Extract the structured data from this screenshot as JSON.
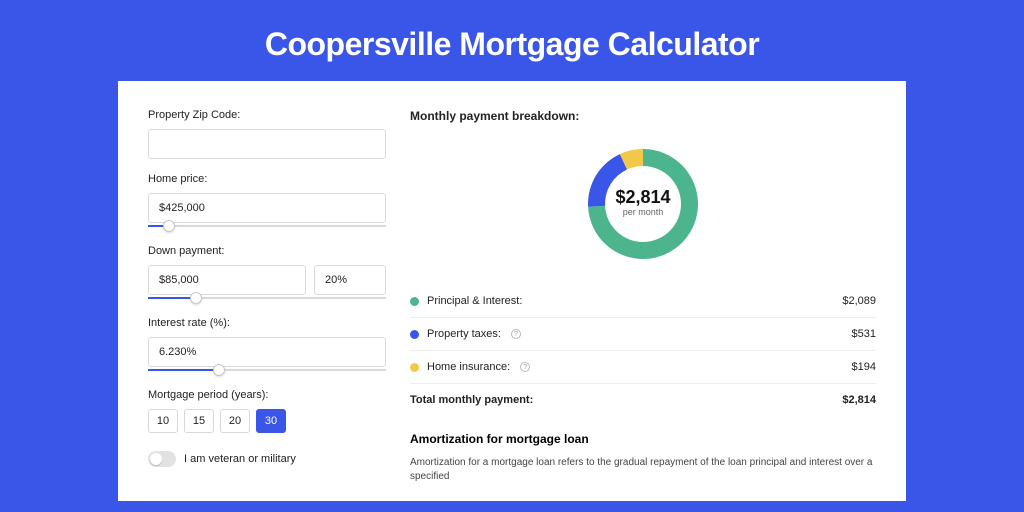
{
  "title": "Coopersville Mortgage Calculator",
  "form": {
    "zip_label": "Property Zip Code:",
    "zip_value": "",
    "home_price_label": "Home price:",
    "home_price_value": "$425,000",
    "home_price_slider_pct": 9,
    "down_payment_label": "Down payment:",
    "down_payment_value": "$85,000",
    "down_payment_pct_value": "20%",
    "down_payment_slider_pct": 20,
    "interest_label": "Interest rate (%):",
    "interest_value": "6.230%",
    "interest_slider_pct": 30,
    "period_label": "Mortgage period (years):",
    "periods": [
      "10",
      "15",
      "20",
      "30"
    ],
    "period_selected": "30",
    "veteran_label": "I am veteran or military",
    "veteran_on": false
  },
  "breakdown": {
    "title": "Monthly payment breakdown:",
    "center_amount": "$2,814",
    "center_sub": "per month",
    "items": [
      {
        "label": "Principal & Interest:",
        "value": "$2,089",
        "color": "#4cb58e",
        "help": false,
        "num": 2089
      },
      {
        "label": "Property taxes:",
        "value": "$531",
        "color": "#3a56e8",
        "help": true,
        "num": 531
      },
      {
        "label": "Home insurance:",
        "value": "$194",
        "color": "#f2c84b",
        "help": true,
        "num": 194
      }
    ],
    "total_label": "Total monthly payment:",
    "total_value": "$2,814"
  },
  "amortization": {
    "title": "Amortization for mortgage loan",
    "text": "Amortization for a mortgage loan refers to the gradual repayment of the loan principal and interest over a specified"
  },
  "chart_data": {
    "type": "pie",
    "title": "Monthly payment breakdown",
    "series": [
      {
        "name": "Principal & Interest",
        "value": 2089,
        "color": "#4cb58e"
      },
      {
        "name": "Property taxes",
        "value": 531,
        "color": "#3a56e8"
      },
      {
        "name": "Home insurance",
        "value": 194,
        "color": "#f2c84b"
      }
    ],
    "total": 2814,
    "center_label": "$2,814 per month",
    "donut": true
  }
}
